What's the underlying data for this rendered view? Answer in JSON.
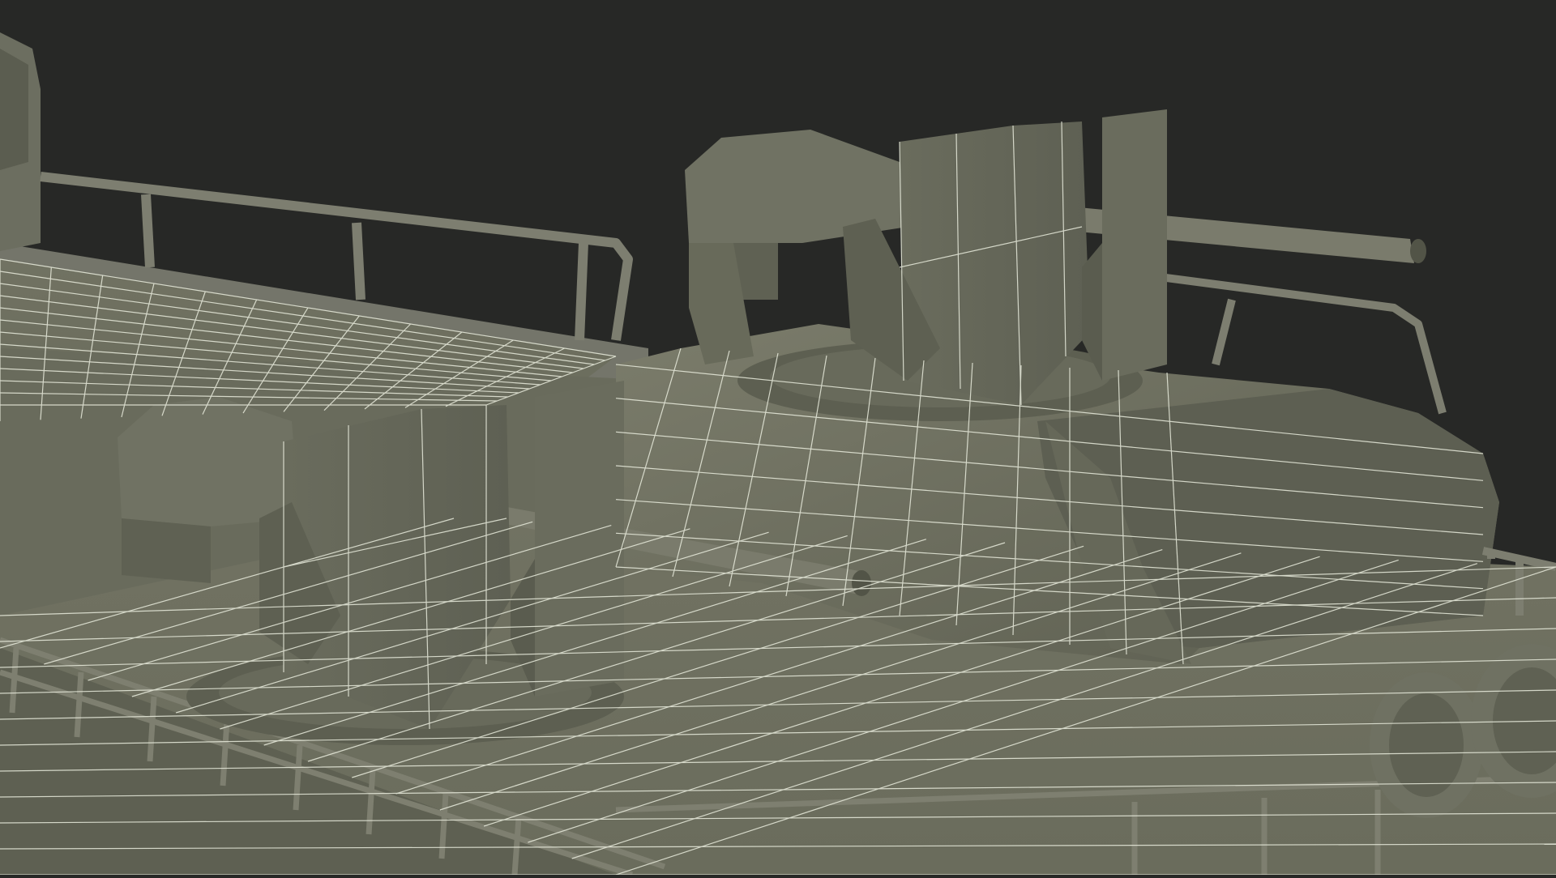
{
  "scene": {
    "subject": "wireframe-render-of-boat-deck-with-two-gun-turrets",
    "colors": {
      "background": "#272826",
      "surface_light": "#7a7b6a",
      "surface_mid": "#686a5b",
      "surface_dark": "#55574a",
      "wire": "#e9ecdd"
    },
    "turrets": [
      {
        "id": "front-turret",
        "label": ""
      },
      {
        "id": "rear-turret",
        "label": ""
      }
    ]
  }
}
